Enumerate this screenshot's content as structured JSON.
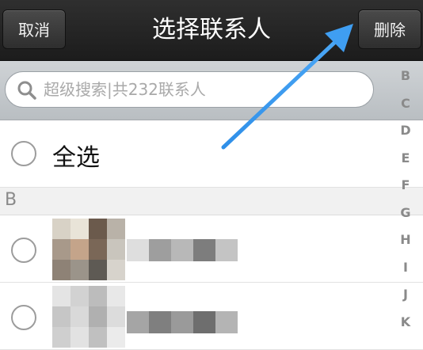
{
  "header": {
    "cancel_label": "取消",
    "title": "选择联系人",
    "delete_label": "删除"
  },
  "search": {
    "placeholder": "超级搜索|共232联系人"
  },
  "index_letters": [
    "B",
    "C",
    "D",
    "E",
    "F",
    "G",
    "H",
    "I",
    "J",
    "K"
  ],
  "select_all": {
    "label": "全选"
  },
  "sections": [
    {
      "header": "B"
    }
  ],
  "colors": {
    "header_bg": "#222222",
    "search_bg": "#c4c9cd",
    "annotation_arrow": "#2f8fe8",
    "index_letter": "#8a8a8a"
  }
}
